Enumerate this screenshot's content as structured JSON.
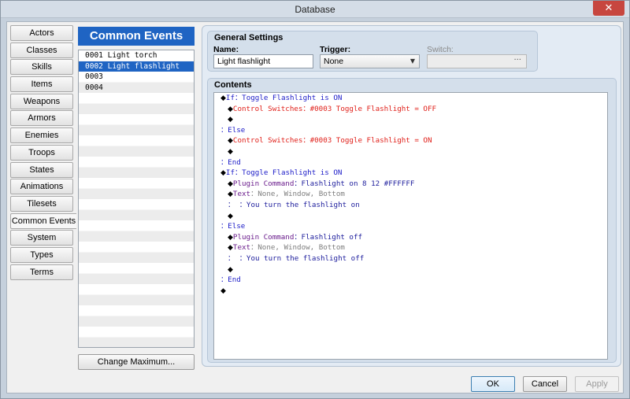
{
  "window": {
    "title": "Database",
    "close_glyph": "✕"
  },
  "sidebar": {
    "items": [
      {
        "label": "Actors"
      },
      {
        "label": "Classes"
      },
      {
        "label": "Skills"
      },
      {
        "label": "Items"
      },
      {
        "label": "Weapons"
      },
      {
        "label": "Armors"
      },
      {
        "label": "Enemies"
      },
      {
        "label": "Troops"
      },
      {
        "label": "States"
      },
      {
        "label": "Animations"
      },
      {
        "label": "Tilesets"
      },
      {
        "label": "Common Events",
        "active": true
      },
      {
        "label": "System"
      },
      {
        "label": "Types"
      },
      {
        "label": "Terms"
      }
    ]
  },
  "list": {
    "header": "Common Events",
    "items": [
      {
        "label": "0001 Light torch"
      },
      {
        "label": "0002 Light flashlight",
        "selected": true
      },
      {
        "label": "0003"
      },
      {
        "label": "0004"
      }
    ],
    "change_max_label": "Change Maximum..."
  },
  "general": {
    "title": "General Settings",
    "name_label": "Name:",
    "name_value": "Light flashlight",
    "trigger_label": "Trigger:",
    "trigger_value": "None",
    "switch_label": "Switch:",
    "switch_button": "···"
  },
  "contents": {
    "title": "Contents",
    "lines": [
      {
        "indent": 0,
        "segments": [
          {
            "t": "◆",
            "c": "diamond"
          },
          {
            "t": "If",
            "c": "c-blue"
          },
          {
            "t": "：Toggle Flashlight is ON",
            "c": "c-blue"
          }
        ]
      },
      {
        "indent": 1,
        "segments": [
          {
            "t": "◆",
            "c": "diamond"
          },
          {
            "t": "Control Switches：#0003 Toggle Flashlight = OFF",
            "c": "c-red"
          }
        ]
      },
      {
        "indent": 1,
        "segments": [
          {
            "t": "◆",
            "c": "diamond"
          }
        ]
      },
      {
        "indent": 0,
        "segments": [
          {
            "t": "：Else",
            "c": "c-blue"
          }
        ]
      },
      {
        "indent": 1,
        "segments": [
          {
            "t": "◆",
            "c": "diamond"
          },
          {
            "t": "Control Switches：#0003 Toggle Flashlight = ON",
            "c": "c-red"
          }
        ]
      },
      {
        "indent": 1,
        "segments": [
          {
            "t": "◆",
            "c": "diamond"
          }
        ]
      },
      {
        "indent": 0,
        "segments": [
          {
            "t": "：End",
            "c": "c-blue"
          }
        ]
      },
      {
        "indent": 0,
        "segments": [
          {
            "t": "◆",
            "c": "diamond"
          },
          {
            "t": "If",
            "c": "c-blue"
          },
          {
            "t": "：Toggle Flashlight is ON",
            "c": "c-blue"
          }
        ]
      },
      {
        "indent": 1,
        "segments": [
          {
            "t": "◆",
            "c": "diamond"
          },
          {
            "t": "Plugin Command",
            "c": "c-purple"
          },
          {
            "t": "：Flashlight on 8 12 #FFFFFF",
            "c": "c-navy"
          }
        ]
      },
      {
        "indent": 1,
        "segments": [
          {
            "t": "◆",
            "c": "diamond"
          },
          {
            "t": "Text",
            "c": "c-purple"
          },
          {
            "t": "：None, Window, Bottom",
            "c": "c-gray"
          }
        ]
      },
      {
        "indent": 1,
        "segments": [
          {
            "t": "：    ：You turn the flashlight on",
            "c": "c-navy"
          }
        ]
      },
      {
        "indent": 1,
        "segments": [
          {
            "t": "◆",
            "c": "diamond"
          }
        ]
      },
      {
        "indent": 0,
        "segments": [
          {
            "t": "：Else",
            "c": "c-blue"
          }
        ]
      },
      {
        "indent": 1,
        "segments": [
          {
            "t": "◆",
            "c": "diamond"
          },
          {
            "t": "Plugin Command",
            "c": "c-purple"
          },
          {
            "t": "：Flashlight off",
            "c": "c-navy"
          }
        ]
      },
      {
        "indent": 1,
        "segments": [
          {
            "t": "◆",
            "c": "diamond"
          },
          {
            "t": "Text",
            "c": "c-purple"
          },
          {
            "t": "：None, Window, Bottom",
            "c": "c-gray"
          }
        ]
      },
      {
        "indent": 1,
        "segments": [
          {
            "t": "：    ：You turn the flashlight off",
            "c": "c-navy"
          }
        ]
      },
      {
        "indent": 1,
        "segments": [
          {
            "t": "◆",
            "c": "diamond"
          }
        ]
      },
      {
        "indent": 0,
        "segments": [
          {
            "t": "：End",
            "c": "c-blue"
          }
        ]
      },
      {
        "indent": 0,
        "segments": [
          {
            "t": "◆",
            "c": "diamond"
          }
        ]
      }
    ]
  },
  "buttons": {
    "ok": "OK",
    "cancel": "Cancel",
    "apply": "Apply"
  },
  "colors": {
    "accent": "#1f64c3",
    "red_command": "#e0201a",
    "purple_command": "#6a1c8c",
    "blue_flow": "#1c1cc8"
  }
}
